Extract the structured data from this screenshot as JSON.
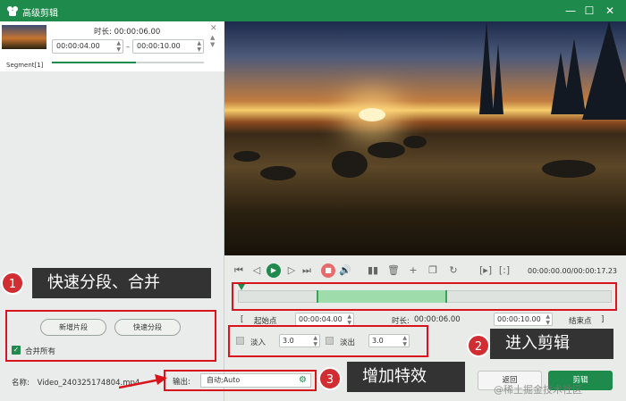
{
  "window": {
    "title": "高级剪辑",
    "minimize": "—",
    "maximize": "☐",
    "close": "✕"
  },
  "segment": {
    "duration_label": "时长:",
    "duration_value": "00:00:06.00",
    "start": "00:00:04.00",
    "end": "00:00:10.00",
    "dash": "–",
    "label": "Segment[1]",
    "progress": 0.55
  },
  "callouts": [
    {
      "number": "1",
      "text": "快速分段、合并"
    },
    {
      "number": "2",
      "text": "进入剪辑"
    },
    {
      "number": "3",
      "text": "增加特效"
    }
  ],
  "segment_actions": {
    "new_segment": "新增片段",
    "quick_split": "快速分段",
    "merge_all": "合并所有"
  },
  "player": {
    "timecode": "00:00:00.00/00:00:17.23",
    "selection_start": 0.21,
    "selection_end": 0.56
  },
  "trim": {
    "start_label": "起始点",
    "start_value": "00:00:04.00",
    "duration_label": "时长:",
    "duration_value": "00:00:06.00",
    "end_value": "00:00:10.00",
    "end_label": "结束点",
    "open_bracket": "[",
    "close_bracket": "]"
  },
  "effects": {
    "fade_in_label": "淡入",
    "fade_in_value": "3.0",
    "fade_out_label": "淡出",
    "fade_out_value": "3.0"
  },
  "footer": {
    "name_label": "名称:",
    "file_name": "Video_240325174804.mp4",
    "output_label": "输出:",
    "output_value": "自动;Auto",
    "back_button": "返回",
    "edit_button": "剪辑",
    "watermark": "@稀土掘金技术社区"
  },
  "colors": {
    "brand": "#1e8a4c",
    "highlight": "#d8141c",
    "callout_bg": "#333333"
  }
}
